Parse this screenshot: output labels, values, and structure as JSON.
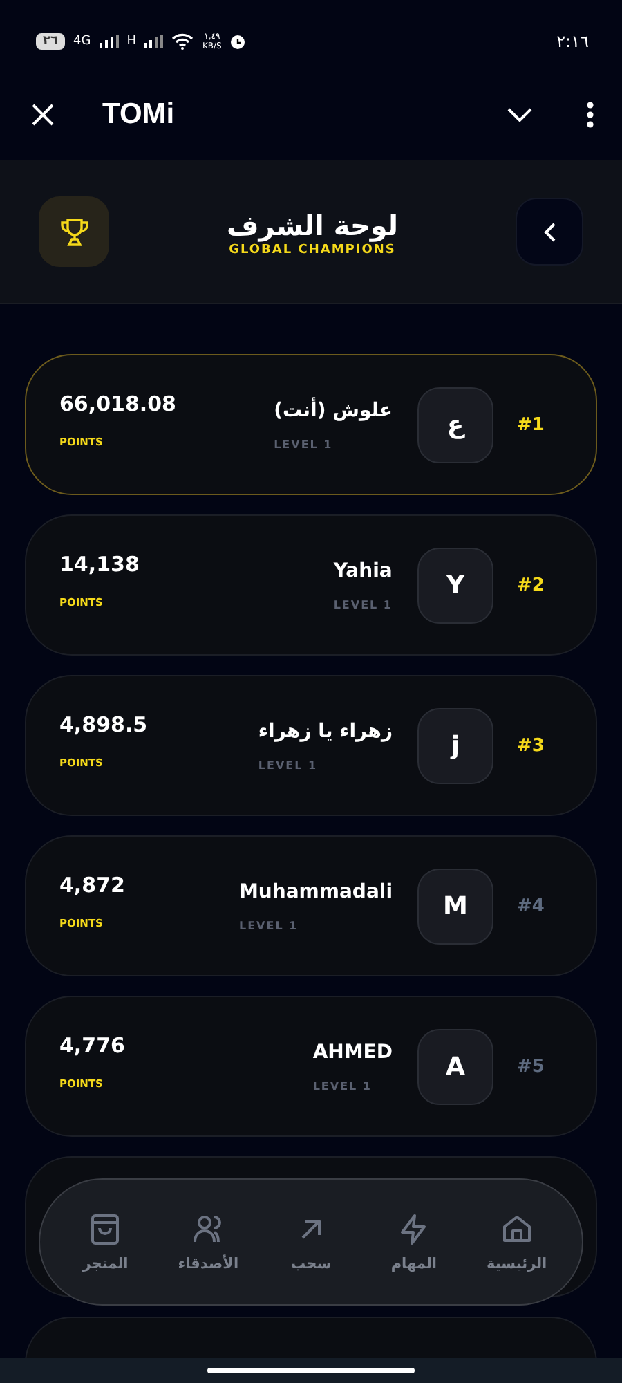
{
  "status_bar": {
    "battery": "٢٦",
    "network_1": "4G",
    "network_2": "H",
    "speed_value": "١,٤٩",
    "speed_unit": "KB/S",
    "time": "٢:١٦"
  },
  "app_bar": {
    "title": "TOMi"
  },
  "header": {
    "title": "لوحة الشرف",
    "subtitle": "GLOBAL CHAMPIONS"
  },
  "entries": [
    {
      "rank": "#1",
      "top": true,
      "current": true,
      "initial": "ع",
      "name": "علوش (أنت)",
      "level": "LEVEL 1",
      "points": "66,018.08",
      "points_label": "POINTS"
    },
    {
      "rank": "#2",
      "top": true,
      "current": false,
      "initial": "Y",
      "name": "Yahia",
      "level": "LEVEL 1",
      "points": "14,138",
      "points_label": "POINTS"
    },
    {
      "rank": "#3",
      "top": true,
      "current": false,
      "initial": "j",
      "name": "زهراء يا زهراء",
      "level": "LEVEL 1",
      "points": "4,898.5",
      "points_label": "POINTS"
    },
    {
      "rank": "#4",
      "top": false,
      "current": false,
      "initial": "M",
      "name": "Muhammadali",
      "level": "LEVEL 1",
      "points": "4,872",
      "points_label": "POINTS"
    },
    {
      "rank": "#5",
      "top": false,
      "current": false,
      "initial": "A",
      "name": "AHMED",
      "level": "LEVEL 1",
      "points": "4,776",
      "points_label": "POINTS"
    }
  ],
  "nav": [
    {
      "kind": "home",
      "label": "الرئيسية",
      "selected": false
    },
    {
      "kind": "tasks",
      "label": "المهام",
      "selected": false
    },
    {
      "kind": "withdraw",
      "label": "سحب",
      "selected": false
    },
    {
      "kind": "friends",
      "label": "الأصدقاء",
      "selected": false
    },
    {
      "kind": "store",
      "label": "المتجر",
      "selected": false
    }
  ]
}
